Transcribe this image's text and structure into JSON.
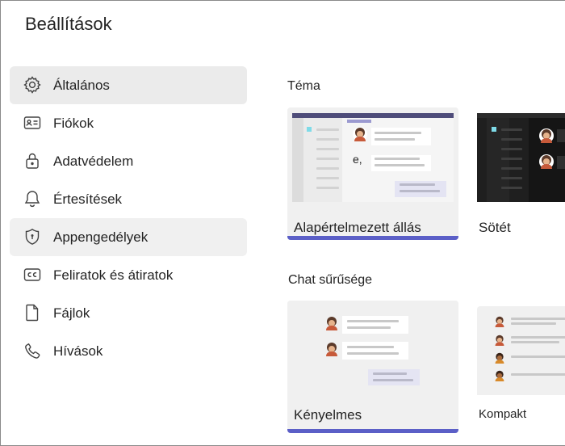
{
  "header": {
    "title": "Beállítások"
  },
  "sidebar": {
    "items": [
      {
        "label": "Általános",
        "icon": "gear-icon"
      },
      {
        "label": "Fiókok",
        "icon": "id-card-icon"
      },
      {
        "label": "Adatvédelem",
        "icon": "lock-icon"
      },
      {
        "label": "Értesítések",
        "icon": "bell-icon"
      },
      {
        "label": "Appengedélyek",
        "icon": "shield-icon"
      },
      {
        "label": "Feliratok és átiratok",
        "icon": "closed-caption-icon"
      },
      {
        "label": "Fájlok",
        "icon": "file-icon"
      },
      {
        "label": "Hívások",
        "icon": "phone-icon"
      }
    ],
    "active_index": 0,
    "hovered_index": 4
  },
  "theme": {
    "section_title": "Téma",
    "options": [
      {
        "label": "Alapértelmezett állás",
        "selected": true,
        "preview_text": "e,"
      },
      {
        "label": "Sötét",
        "selected": false
      }
    ]
  },
  "density": {
    "section_title": "Chat sűrűsége",
    "options": [
      {
        "label": "Kényelmes",
        "selected": true
      },
      {
        "label": "Kompakt",
        "selected": false
      }
    ]
  },
  "colors": {
    "accent": "#5b5fc7",
    "active_bg": "#ebebeb",
    "text": "#242424"
  }
}
